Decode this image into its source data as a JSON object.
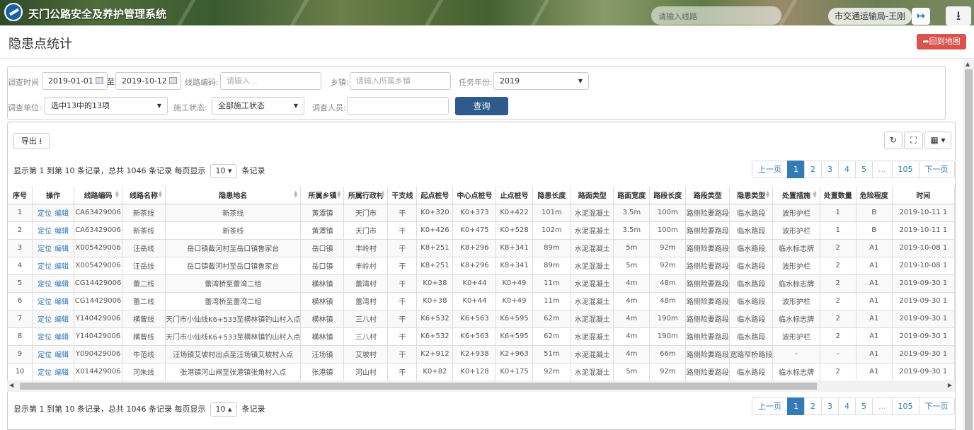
{
  "topbar": {
    "app_title": "天门公路安全及养护管理系统",
    "search_placeholder": "请输入线路",
    "user_label": "市交通运输局-王刚",
    "logout_icon": "↦",
    "download_icon": "⭳"
  },
  "page": {
    "title": "隐患点统计",
    "back_button": "➦回到地图"
  },
  "filters": {
    "date_label": "调查时间",
    "date_from": "2019-01-01",
    "date_sep": "至",
    "date_to": "2019-10-12",
    "route_code_label": "线路编码:",
    "route_code_placeholder": "请输入...",
    "town_label": "乡镇:",
    "town_placeholder": "请输入所属乡镇",
    "year_label": "任务年份:",
    "year_value": "2019",
    "unit_label": "调查单位:",
    "unit_value": "选中13中的13项",
    "construction_label": "施工状态:",
    "construction_value": "全部施工状态",
    "surveyor_label": "调查人员:",
    "surveyor_value": "",
    "query_button": "查询"
  },
  "toolbar": {
    "export_label": "导出 ⭳",
    "refresh_icon": "↻",
    "fullscreen_icon": "⛶",
    "columns_icon": "▦ ▾"
  },
  "info": {
    "summary": "显示第 1 到第 10 条记录，总共 1046 条记录",
    "per_page_label": "每页显示",
    "per_page_top": "10 ▾",
    "per_page_bottom": "10 ▴",
    "records_label": "条记录"
  },
  "pagination": {
    "prev": "上一页",
    "pages": [
      "1",
      "2",
      "3",
      "4",
      "5"
    ],
    "ellipsis": "...",
    "last": "105",
    "next": "下一页"
  },
  "table": {
    "columns": [
      "序号",
      "操作",
      "线路编码",
      "线路名称",
      "隐患地名",
      "所属乡镇",
      "所属行政村",
      "干支线",
      "起点桩号",
      "中心点桩号",
      "止点桩号",
      "隐患长度",
      "路面类型",
      "路面宽度",
      "路段长度",
      "路段类型",
      "隐患类型",
      "处置措施",
      "处置数量",
      "危险程度",
      "时间"
    ],
    "action_locate": "定位",
    "action_edit": "编辑",
    "rows": [
      [
        "1",
        "",
        "CA63429006",
        "新茶线",
        "新茶线",
        "黄潭镇",
        "天门市",
        "干",
        "K0+320",
        "K0+373",
        "K0+422",
        "101m",
        "水泥混凝土",
        "3.5m",
        "100m",
        "路侧险要路段",
        "临水路段",
        "波形护栏",
        "1",
        "B",
        "2019-10-11 1"
      ],
      [
        "2",
        "",
        "CA63429006",
        "新茶线",
        "新茶线",
        "黄潭镇",
        "天门市",
        "干",
        "K0+426",
        "K0+475",
        "K0+528",
        "102m",
        "水泥混凝土",
        "3.5m",
        "100m",
        "路侧险要路段",
        "临水路段",
        "波形护栏",
        "1",
        "B",
        "2019-10-11 1"
      ],
      [
        "3",
        "",
        "X005429006",
        "汪岳线",
        "岳口镇截河村至岳口镇鲁家台",
        "岳口镇",
        "丰岭村",
        "干",
        "K8+251",
        "K8+296",
        "K8+341",
        "89m",
        "水泥混凝土",
        "5m",
        "92m",
        "路侧险要路段",
        "临水路段",
        "临水标志牌",
        "2",
        "A1",
        "2019-10-08 1"
      ],
      [
        "4",
        "",
        "X005429006",
        "汪岳线",
        "岳口镇截河村至岳口镇鲁家台",
        "岳口镇",
        "丰岭村",
        "干",
        "K8+251",
        "K8+296",
        "K8+341",
        "89m",
        "水泥混凝土",
        "5m",
        "92m",
        "路侧险要路段",
        "临水路段",
        "波形护栏",
        "2",
        "A1",
        "2019-10-08 1"
      ],
      [
        "5",
        "",
        "CG14429006",
        "蕾二线",
        "蕾湾桥至蕾湾二组",
        "横林镇",
        "蕾湾村",
        "干",
        "K0+38",
        "K0+44",
        "K0+49",
        "11m",
        "水泥混凝土",
        "4m",
        "48m",
        "路侧险要路段",
        "临水路段",
        "临水标志牌",
        "2",
        "A1",
        "2019-09-30 1"
      ],
      [
        "6",
        "",
        "CG14429006",
        "蕾二线",
        "蕾湾桥至蕾湾二组",
        "横林镇",
        "蕾湾村",
        "干",
        "K0+38",
        "K0+44",
        "K0+49",
        "11m",
        "水泥混凝土",
        "4m",
        "48m",
        "路侧险要路段",
        "临水路段",
        "波形护栏",
        "2",
        "A1",
        "2019-09-30 1"
      ],
      [
        "7",
        "",
        "Y140429006",
        "横曾线",
        "天门市小仙线K6+533至横林镇钓山村入点",
        "横林镇",
        "三八村",
        "干",
        "K6+532",
        "K6+563",
        "K6+595",
        "62m",
        "水泥混凝土",
        "4m",
        "190m",
        "路侧险要路段",
        "临水路段",
        "临水标志牌",
        "2",
        "A1",
        "2019-09-30 1"
      ],
      [
        "8",
        "",
        "Y140429006",
        "横曾线",
        "天门市小仙线K6+533至横林镇钓山村入点",
        "横林镇",
        "三八村",
        "干",
        "K6+532",
        "K6+563",
        "K6+595",
        "62m",
        "水泥混凝土",
        "4m",
        "190m",
        "路侧险要路段",
        "临水路段",
        "波形护栏",
        "2",
        "A1",
        "2019-09-30 1"
      ],
      [
        "9",
        "",
        "Y090429006",
        "牛范线",
        "汪场镇艾坡村出点至汪场镇艾坡村入点",
        "汪场镇",
        "艾坡村",
        "干",
        "K2+912",
        "K2+938",
        "K2+963",
        "51m",
        "水泥混凝土",
        "4m",
        "66m",
        "路侧险要路段",
        "宽路窄桥路段",
        "-",
        "-",
        "A1",
        "2019-09-30 1"
      ],
      [
        "10",
        "",
        "X014429006",
        "河朱线",
        "张港镇河山闸至张港镇张角村入点",
        "张港镇",
        "河山村",
        "干",
        "K0+82",
        "K0+128",
        "K0+175",
        "92m",
        "水泥混凝土",
        "5m",
        "92m",
        "路侧险要路段",
        "临水路段",
        "临水标志牌",
        "2",
        "A1",
        "2019-09-30 1"
      ]
    ]
  }
}
